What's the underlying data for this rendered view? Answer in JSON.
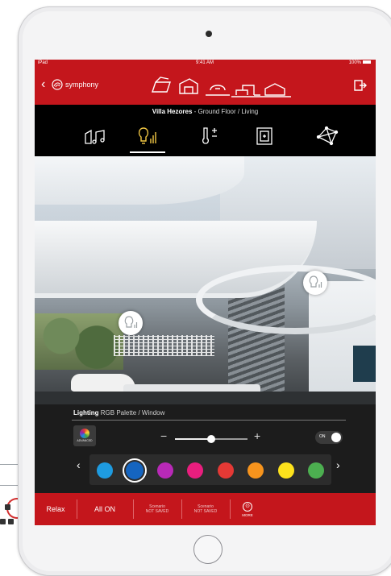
{
  "status_bar": {
    "carrier": "iPad",
    "time": "9:41 AM",
    "battery": "100%"
  },
  "nav": {
    "app_name": "symphony"
  },
  "breadcrumb": {
    "location_bold": "Villa Hezores",
    "location_rest": "- Ground Floor / Living"
  },
  "tabs": [
    "multimedia-tab",
    "lighting-tab",
    "climate-tab",
    "window-tab",
    "network-tab"
  ],
  "panel": {
    "title_bold": "Lighting",
    "title_rest": "RGB Palette / Window",
    "advanced_label": "ADVANCED",
    "minus": "−",
    "plus": "+",
    "toggle_label": "ON",
    "slider_percent": 50,
    "palette_colors": [
      "#1e9be0",
      "#1565c0",
      "#b829b7",
      "#e91e7e",
      "#e53935",
      "#f7941d",
      "#fde21c",
      "#4caf50"
    ],
    "selected_index": 1,
    "left_arrow": "‹",
    "right_arrow": "›"
  },
  "bottom_bar": {
    "relax": "Relax",
    "all_on": "All ON",
    "scenario1_title": "Scenario",
    "scenario1_sub": "NOT SAVED",
    "scenario2_title": "Scenario",
    "scenario2_sub": "NOT SAVED",
    "more_label": "MORE"
  },
  "colors": {
    "brand_red": "#c4161c"
  }
}
